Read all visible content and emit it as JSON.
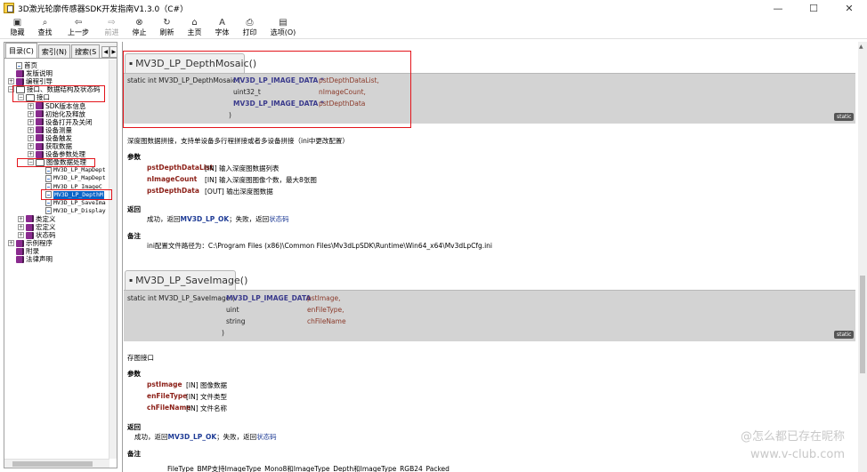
{
  "window": {
    "title": "3D激光轮廓传感器SDK开发指南V1.3.0（C#）",
    "controls": {
      "minimize": "—",
      "maximize": "☐",
      "close": "✕"
    }
  },
  "toolbar": [
    {
      "name": "hide",
      "label": "隐藏",
      "icon": "hide-icon",
      "glyph": "▣"
    },
    {
      "name": "find",
      "label": "查找",
      "icon": "find-icon",
      "glyph": "⌕"
    },
    {
      "name": "back",
      "label": "上一步",
      "icon": "back-arrow-icon",
      "glyph": "⇦"
    },
    {
      "name": "forward",
      "label": "前进",
      "icon": "forward-arrow-icon",
      "glyph": "⇨",
      "disabled": true
    },
    {
      "name": "stop",
      "label": "停止",
      "icon": "stop-icon",
      "glyph": "⊗"
    },
    {
      "name": "refresh",
      "label": "刷新",
      "icon": "refresh-icon",
      "glyph": "↻"
    },
    {
      "name": "home",
      "label": "主页",
      "icon": "home-icon",
      "glyph": "⌂"
    },
    {
      "name": "font",
      "label": "字体",
      "icon": "font-icon",
      "glyph": "A"
    },
    {
      "name": "print",
      "label": "打印",
      "icon": "print-icon",
      "glyph": "⎙"
    },
    {
      "name": "options",
      "label": "选项(O)",
      "icon": "options-icon",
      "glyph": "▤"
    }
  ],
  "nav": {
    "tabs": [
      "目录(C)",
      "索引(N)",
      "搜索(S"
    ],
    "tab_arrows": [
      "◀",
      "▶"
    ],
    "tree": [
      {
        "label": "首页",
        "icon": "page",
        "indent": 0,
        "expander": ""
      },
      {
        "label": "发版说明",
        "icon": "book",
        "indent": 0,
        "expander": ""
      },
      {
        "label": "编程引导",
        "icon": "book",
        "indent": 0,
        "expander": "+"
      },
      {
        "label": "接口、数据结构及状态码",
        "icon": "openbook",
        "indent": 0,
        "expander": "−"
      },
      {
        "label": "接口",
        "icon": "openbook",
        "indent": 1,
        "expander": "−"
      },
      {
        "label": "SDK版本信息",
        "icon": "book",
        "indent": 2,
        "expander": "+"
      },
      {
        "label": "初始化及释放",
        "icon": "book",
        "indent": 2,
        "expander": "+"
      },
      {
        "label": "设备打开及关闭",
        "icon": "book",
        "indent": 2,
        "expander": "+"
      },
      {
        "label": "设备测量",
        "icon": "book",
        "indent": 2,
        "expander": "+"
      },
      {
        "label": "设备触发",
        "icon": "book",
        "indent": 2,
        "expander": "+"
      },
      {
        "label": "获取数据",
        "icon": "book",
        "indent": 2,
        "expander": "+"
      },
      {
        "label": "设备参数处理",
        "icon": "book",
        "indent": 2,
        "expander": "+"
      },
      {
        "label": "图像数据处理",
        "icon": "openbook",
        "indent": 2,
        "expander": "−"
      },
      {
        "label": "MV3D_LP_MapDept",
        "icon": "page",
        "indent": 3,
        "expander": "",
        "mono": true
      },
      {
        "label": "MV3D_LP_MapDept",
        "icon": "page",
        "indent": 3,
        "expander": "",
        "mono": true
      },
      {
        "label": "MV3D_LP_ImageC",
        "icon": "page",
        "indent": 3,
        "expander": "",
        "mono": true
      },
      {
        "label": "MV3D_LP_DepthM",
        "icon": "page",
        "indent": 3,
        "expander": "",
        "mono": true,
        "selected": true
      },
      {
        "label": "MV3D_LP_SaveIma",
        "icon": "page",
        "indent": 3,
        "expander": "",
        "mono": true
      },
      {
        "label": "MV3D_LP_Display",
        "icon": "page",
        "indent": 3,
        "expander": "",
        "mono": true
      },
      {
        "label": "类定义",
        "icon": "book",
        "indent": 1,
        "expander": "+"
      },
      {
        "label": "宏定义",
        "icon": "book",
        "indent": 1,
        "expander": "+"
      },
      {
        "label": "状态码",
        "icon": "book",
        "indent": 1,
        "expander": "+"
      },
      {
        "label": "示例程序",
        "icon": "book",
        "indent": 0,
        "expander": "+"
      },
      {
        "label": "附录",
        "icon": "book",
        "indent": 0,
        "expander": ""
      },
      {
        "label": "法律声明",
        "icon": "book",
        "indent": 0,
        "expander": ""
      }
    ]
  },
  "sections": [
    {
      "title": "MV3D_LP_DepthMosaic()",
      "bullet": "▪",
      "signature": {
        "prefix": "static int MV3D_LP_DepthMosaic (",
        "params": [
          {
            "type": "MV3D_LP_IMAGE_DATA *",
            "name": "pstDepthDataList,"
          },
          {
            "type": "uint32_t",
            "name": "nImageCount,"
          },
          {
            "type": "MV3D_LP_IMAGE_DATA *",
            "name": "pstDepthData"
          }
        ],
        "suffix": ")"
      },
      "badge": "static",
      "description": "深度图数据拼接，支持单设备多行程拼接或者多设备拼接（ini中更改配置）",
      "params_heading": "参数",
      "param_list": [
        {
          "name": "pstDepthDataList",
          "desc": "[IN] 输入深度图数据列表"
        },
        {
          "name": "nImageCount",
          "desc": "[IN] 输入深度图图像个数，最大8张图"
        },
        {
          "name": "pstDepthData",
          "desc": "[OUT] 输出深度图数据"
        }
      ],
      "return_heading": "返回",
      "return_text": {
        "pre": "成功，返回",
        "ok": "MV3D_LP_OK",
        "mid": "；失败，返回",
        "link": "状态码"
      },
      "note_heading": "备注",
      "note_text": "ini配置文件路径为：C:\\Program Files (x86)\\Common Files\\Mv3dLpSDK\\Runtime\\Win64_x64\\Mv3dLpCfg.ini"
    },
    {
      "title": "MV3D_LP_SaveImage()",
      "bullet": "▪",
      "signature": {
        "prefix": "static int MV3D_LP_SaveImage (",
        "params": [
          {
            "type": "MV3D_LP_IMAGE_DATA",
            "name": "pstImage,"
          },
          {
            "type": "uint",
            "name": "enFileType,"
          },
          {
            "type": "string",
            "name": "chFileName"
          }
        ],
        "suffix": ")"
      },
      "badge": "static",
      "description": "存图接口",
      "params_heading": "参数",
      "param_list": [
        {
          "name": "pstImage",
          "desc": "[IN] 图像数据"
        },
        {
          "name": "enFileType",
          "desc": "[IN] 文件类型"
        },
        {
          "name": "chFileName",
          "desc": "[IN] 文件名称"
        }
      ],
      "return_heading": "返回",
      "return_text": {
        "pre": "成功，返回",
        "ok": "MV3D_LP_OK",
        "mid": "；失败，返回",
        "link": "状态码"
      },
      "note_heading": "备注",
      "note_text": "FileType_BMP支持ImageType_Mono8和ImageType_Depth和ImageType_RGB24_Packed"
    }
  ],
  "watermark": [
    "@怎么都已存在昵称",
    "www.v-club.com"
  ],
  "colors": {
    "highlight_box": "#e3141b",
    "tree_selected": "#0a64c8",
    "signature_bg": "#d3d3d3"
  }
}
